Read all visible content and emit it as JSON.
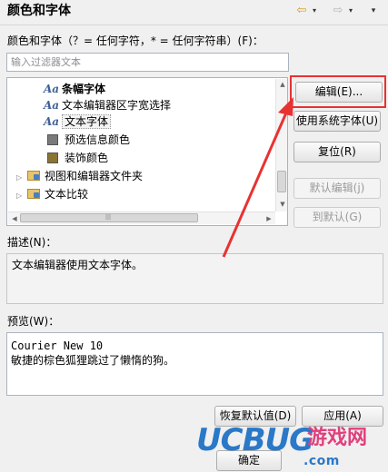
{
  "header": {
    "title": "颜色和字体",
    "back_icon": "⇦",
    "forward_icon": "⇨",
    "dropdown_icon": "▾"
  },
  "filter": {
    "label": "颜色和字体（？= 任何字符，* = 任何字符串）(F)：",
    "placeholder": "输入过滤器文本"
  },
  "tree": {
    "items": [
      {
        "label": "条幅字体",
        "icon": "font-icon",
        "bold": true
      },
      {
        "label": "文本编辑器区字宽选择",
        "icon": "font-icon"
      },
      {
        "label": "文本字体",
        "icon": "font-icon",
        "selected": true
      },
      {
        "label": "预选信息颜色",
        "icon": "color-swatch-icon",
        "color": "#7a7a7a"
      },
      {
        "label": "装饰颜色",
        "icon": "color-swatch-icon",
        "color": "#8a7434"
      },
      {
        "label": "视图和编辑器文件夹",
        "icon": "folder-icon"
      },
      {
        "label": "文本比较",
        "icon": "folder-icon"
      }
    ],
    "font_glyph": "Aa",
    "expand_glyph": "▷"
  },
  "buttons": {
    "edit": "编辑(E)...",
    "use_system_font": "使用系统字体(U)",
    "reset": "复位(R)",
    "edit_default": "默认编辑(j)",
    "goto_default": "到默认(G)",
    "restore_defaults": "恢复默认值(D)",
    "apply": "应用(A)",
    "ok": "确定"
  },
  "description": {
    "label": "描述(N)：",
    "text": "文本编辑器使用文本字体。"
  },
  "preview": {
    "label": "预览(W)：",
    "line1": "Courier New 10",
    "line2": "敏捷的棕色狐狸跳过了懒惰的狗。"
  },
  "watermark": {
    "logo_uc": "UC",
    "logo_bug": "BUG",
    "logo_cn": "游戏网",
    "url": ".com"
  },
  "colors": {
    "highlight": "#e83232",
    "accent": "#3d5f95"
  }
}
